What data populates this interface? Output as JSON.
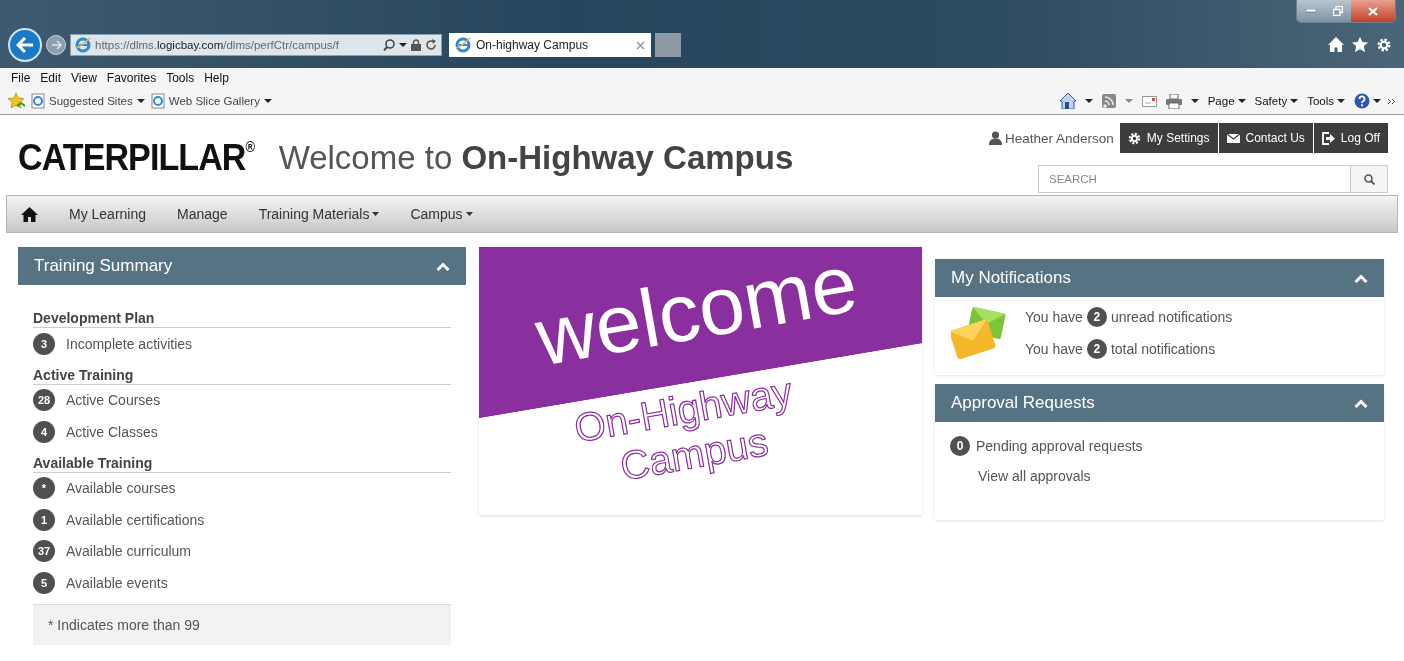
{
  "browser": {
    "url": "https://dlms.**logicbay.com**/dlms/perfCtr/campus/f",
    "tab": {
      "title": "On-highway Campus"
    },
    "menu": [
      "File",
      "Edit",
      "View",
      "Favorites",
      "Tools",
      "Help"
    ],
    "favorites": [
      {
        "label": "Suggested Sites"
      },
      {
        "label": "Web Slice Gallery"
      }
    ],
    "commands": [
      {
        "label": "Page"
      },
      {
        "label": "Safety"
      },
      {
        "label": "Tools"
      }
    ]
  },
  "header": {
    "logo": "CATERPILLAR$^{®}$",
    "title": "Welcome to **On-Highway Campus**",
    "user": "Heather Anderson",
    "buttons": [
      {
        "kind": "settings",
        "label": "My Settings"
      },
      {
        "kind": "contact",
        "label": "Contact Us"
      },
      {
        "kind": "logoff",
        "label": "Log Off"
      }
    ],
    "search": {
      "placeholder": "SEARCH"
    }
  },
  "nav": [
    {
      "label": "My Learning",
      "dropdown": false
    },
    {
      "label": "Manage",
      "dropdown": false
    },
    {
      "label": "Training Materials",
      "dropdown": true
    },
    {
      "label": "Campus",
      "dropdown": true
    }
  ],
  "training_summary": {
    "title": "Training Summary",
    "expanded": true,
    "sections": [
      {
        "heading": "Development Plan",
        "items": [
          {
            "count": "3",
            "label": "Incomplete activities"
          }
        ]
      },
      {
        "heading": "Active Training",
        "items": [
          {
            "count": "28",
            "label": "Active Courses"
          },
          {
            "count": "4",
            "label": "Active Classes"
          }
        ]
      },
      {
        "heading": "Available Training",
        "items": [
          {
            "count": "*",
            "label": "Available courses"
          },
          {
            "count": "1",
            "label": "Available certifications"
          },
          {
            "count": "37",
            "label": "Available curriculum"
          },
          {
            "count": "5",
            "label": "Available events"
          }
        ]
      }
    ],
    "footnote": "* Indicates more than 99"
  },
  "banner": {
    "word": "welcome",
    "line1": "On-Highway",
    "line2": "Campus"
  },
  "notifications": {
    "title": "My Notifications",
    "expanded": true,
    "items": [
      {
        "before": "You have",
        "count": "2",
        "after": "unread notifications"
      },
      {
        "before": "You have",
        "count": "2",
        "after": "total notifications"
      }
    ]
  },
  "approvals": {
    "title": "Approval Requests",
    "expanded": true,
    "count": "0",
    "label": "Pending approval requests",
    "link": "View all approvals"
  }
}
